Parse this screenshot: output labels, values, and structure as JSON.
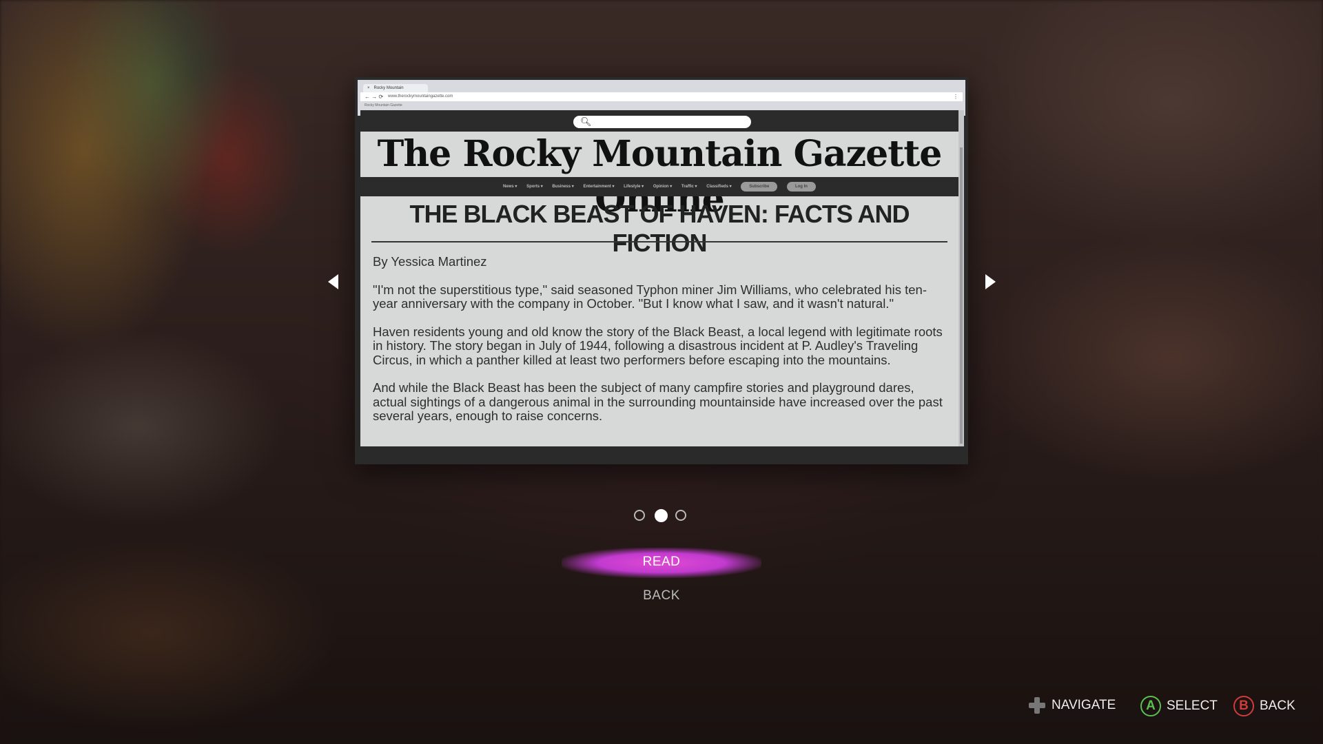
{
  "browser": {
    "tab_label": "Rocky Mountain",
    "tab_close": "×",
    "address": "www.therockymountaingazette.com",
    "bookmarks": "Rocky Mountain Gazette",
    "nav_icons": "← → ⟳",
    "menu_dots": "⋮"
  },
  "site": {
    "search_placeholder": "",
    "masthead": "The Rocky Mountain Gazette Online",
    "nav_items": [
      "News ▾",
      "Sports ▾",
      "Business ▾",
      "Entertainment ▾",
      "Lifestyle ▾",
      "Opinion ▾",
      "Traffic ▾",
      "Classifieds ▾"
    ],
    "subscribe_label": "Subscribe",
    "login_label": "Log In"
  },
  "article": {
    "headline": "THE BLACK BEAST OF HAVEN: FACTS AND FICTION",
    "byline": "By Yessica Martinez",
    "paragraphs": [
      "\"I'm not the superstitious type,\" said seasoned Typhon miner Jim Williams, who celebrated his ten-year anniversary with the company in October. \"But I know what I saw, and it wasn't natural.\"",
      "Haven residents young and old know the story of the Black Beast, a local legend with legitimate roots in history. The story began in July of 1944, following a disastrous incident at P. Audley's Traveling Circus, in which a panther killed at least two performers before escaping into the mountains.",
      "And while the Black Beast has been the subject of many campfire stories and playground dares, actual sightings of a dangerous animal in the surrounding mountainside have increased over the past several years, enough to raise concerns."
    ]
  },
  "pagination": {
    "current": 2,
    "total": 3
  },
  "menu": {
    "read_label": "READ",
    "back_label": "BACK"
  },
  "hints": {
    "navigate_label": "NAVIGATE",
    "select_label": "SELECT",
    "back_label": "BACK",
    "a_glyph": "A",
    "b_glyph": "B"
  },
  "colors": {
    "accent_glow": "#e04bd0",
    "a_button": "#5bc04f",
    "b_button": "#d03b3b"
  }
}
